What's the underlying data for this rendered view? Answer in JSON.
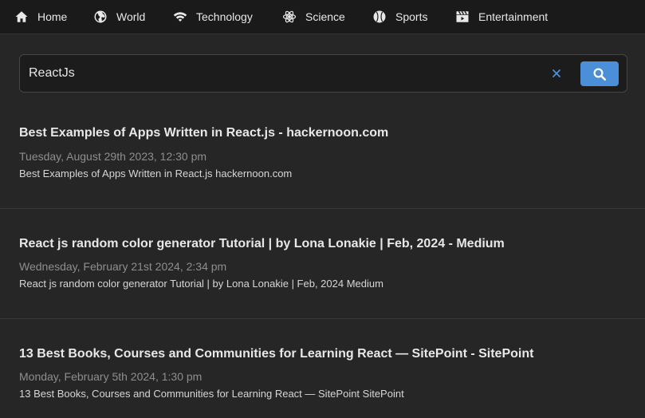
{
  "nav": {
    "items": [
      {
        "label": "Home",
        "icon": "home-icon"
      },
      {
        "label": "World",
        "icon": "globe-icon"
      },
      {
        "label": "Technology",
        "icon": "wifi-icon"
      },
      {
        "label": "Science",
        "icon": "atom-icon"
      },
      {
        "label": "Sports",
        "icon": "baseball-icon"
      },
      {
        "label": "Entertainment",
        "icon": "clapperboard-icon"
      }
    ]
  },
  "search": {
    "value": "ReactJs",
    "clear_icon": "close-icon",
    "button_icon": "search-icon"
  },
  "articles": [
    {
      "title": "Best Examples of Apps Written in React.js - hackernoon.com",
      "date": "Tuesday, August 29th 2023, 12:30 pm",
      "description": "Best Examples of Apps Written in React.js  hackernoon.com"
    },
    {
      "title": "React js random color generator Tutorial | by Lona Lonakie | Feb, 2024 - Medium",
      "date": "Wednesday, February 21st 2024, 2:34 pm",
      "description": "React js random color generator Tutorial | by Lona Lonakie | Feb, 2024  Medium"
    },
    {
      "title": "13 Best Books, Courses and Communities for Learning React — SitePoint - SitePoint",
      "date": "Monday, February 5th 2024, 1:30 pm",
      "description": "13 Best Books, Courses and Communities for Learning React — SitePoint  SitePoint"
    }
  ],
  "colors": {
    "background": "#262626",
    "nav_background": "#1a1a1a",
    "accent": "#4a8fd8"
  }
}
